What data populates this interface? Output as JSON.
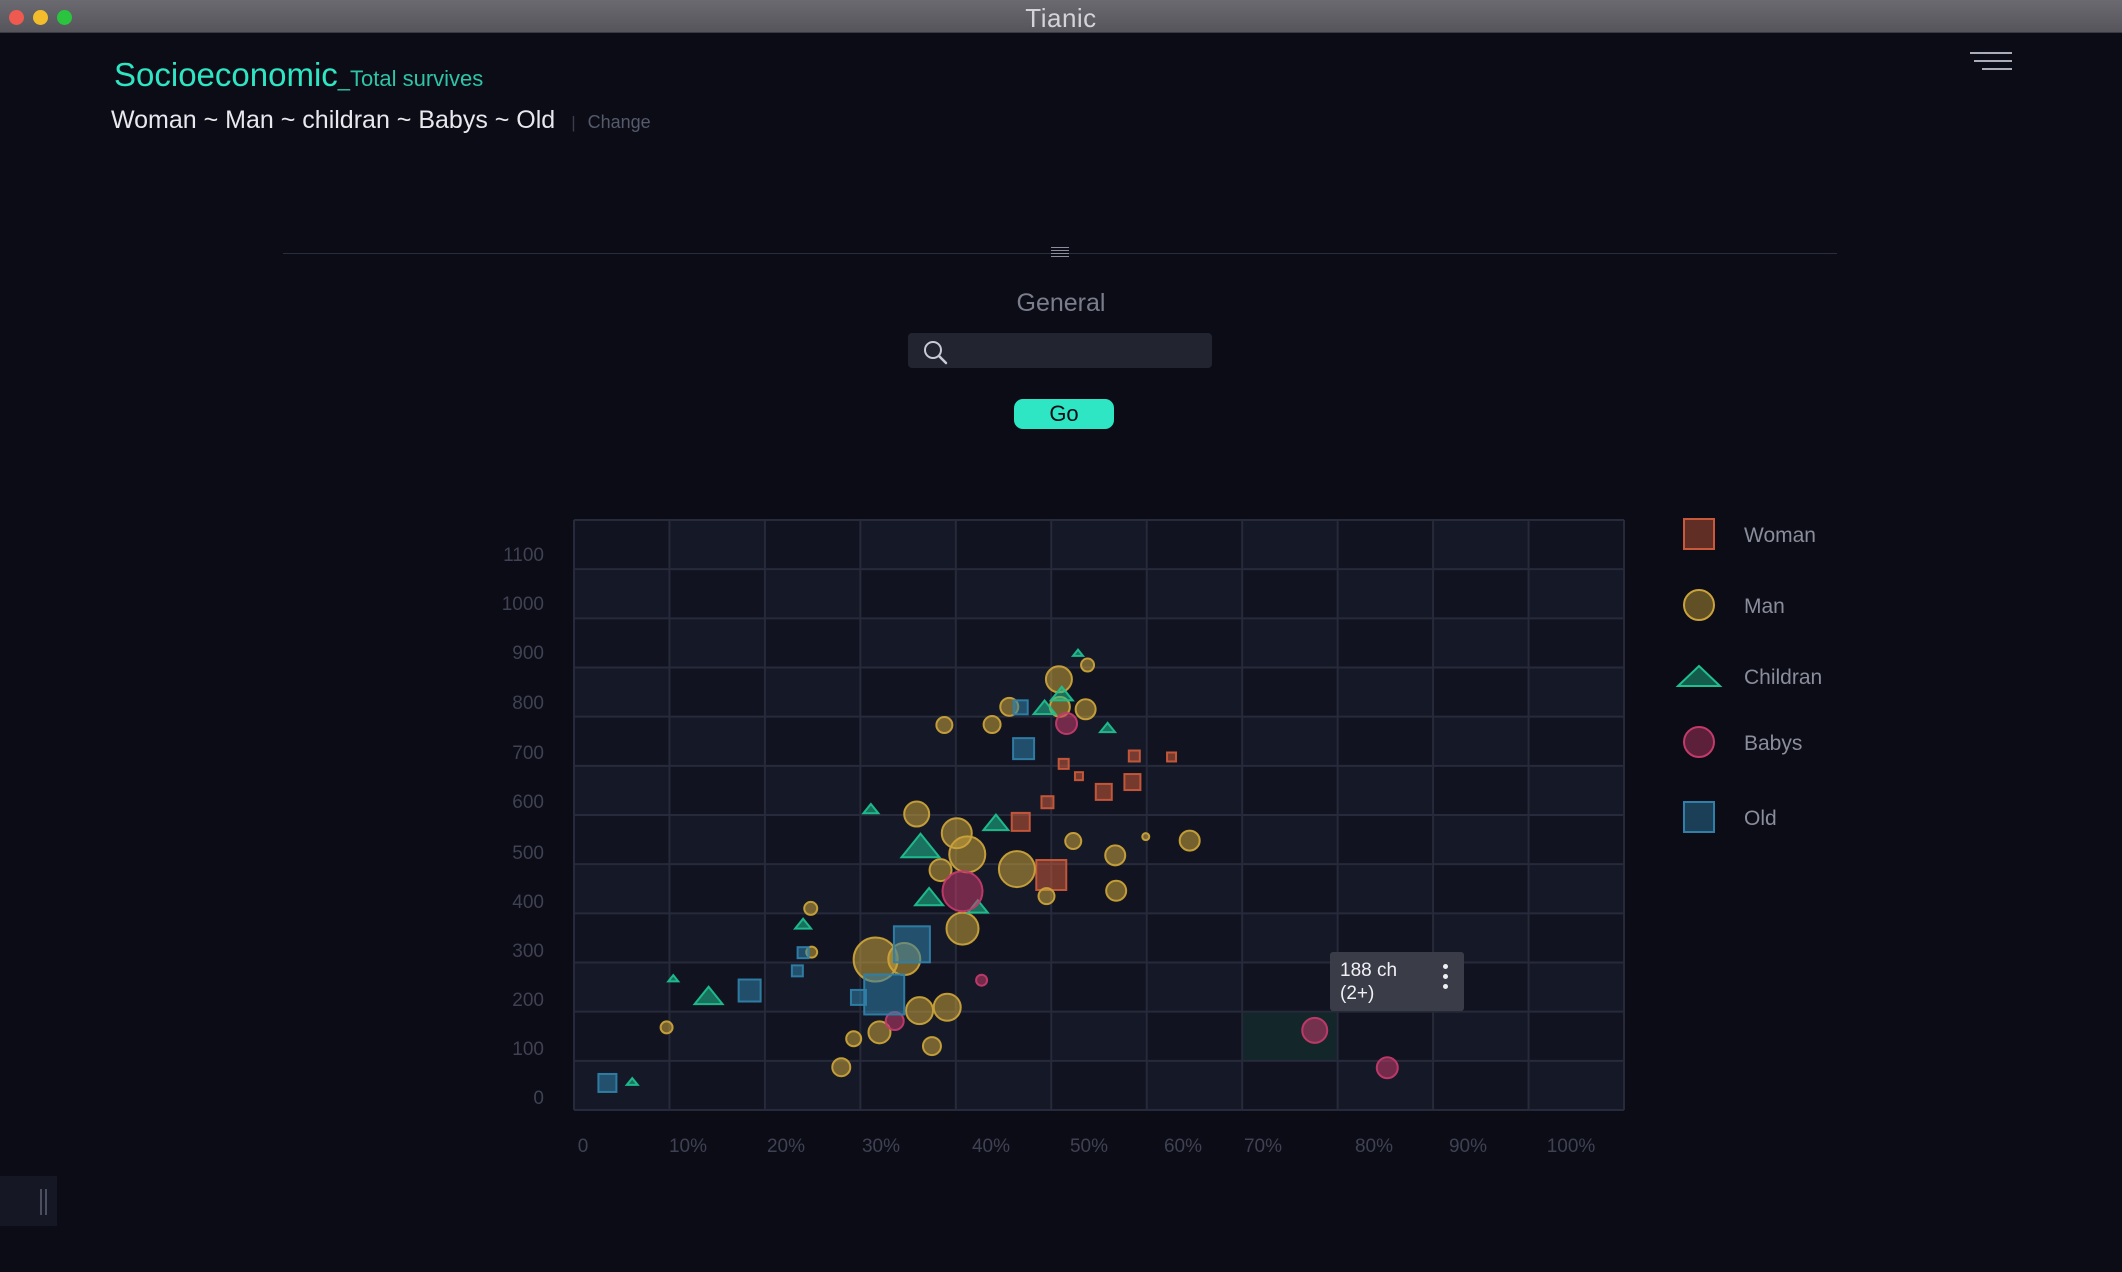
{
  "window": {
    "title": "Tianic"
  },
  "header": {
    "title": "Socioeconomic",
    "subtitle": "_Total survives",
    "filter_text": "Woman ~ Man ~ childran ~ Babys ~ Old",
    "separator": "|",
    "change_label": "Change"
  },
  "panel": {
    "general_label": "General",
    "search_value": "",
    "go_label": "Go"
  },
  "tooltip": {
    "line1": "188 ch",
    "line2": "(2+)"
  },
  "colors": {
    "accent": "#2ee6c4",
    "woman": "#c9593a",
    "man": "#c9a23a",
    "childran": "#1fbf8f",
    "babys": "#c23a6a",
    "old": "#2f7fa8"
  },
  "icons": {
    "menu": "hamburger-menu-icon",
    "search": "magnifier-icon",
    "drag": "drag-handle-icon",
    "more": "vertical-ellipsis-icon"
  },
  "chart_data": {
    "type": "scatter",
    "x_tick_labels": [
      "0",
      "10%",
      "20%",
      "30%",
      "40%",
      "50%",
      "60%",
      "70%",
      "80%",
      "90%",
      "100%"
    ],
    "y_tick_labels": [
      "0",
      "100",
      "200",
      "300",
      "400",
      "500",
      "600",
      "700",
      "800",
      "900",
      "1000",
      "1100"
    ],
    "xlim": [
      0,
      110
    ],
    "ylim": [
      0,
      1200
    ],
    "grid": true,
    "legend_position": "right",
    "highlight_cell": {
      "x": [
        70,
        80
      ],
      "y": [
        100,
        200
      ]
    },
    "series": [
      {
        "name": "Woman",
        "shape": "square",
        "points": [
          {
            "x": 50.0,
            "y": 478,
            "s": 30
          },
          {
            "x": 46.8,
            "y": 586,
            "s": 18
          },
          {
            "x": 49.6,
            "y": 626,
            "s": 12
          },
          {
            "x": 51.3,
            "y": 704,
            "s": 10
          },
          {
            "x": 52.9,
            "y": 679,
            "s": 8
          },
          {
            "x": 55.5,
            "y": 647,
            "s": 16
          },
          {
            "x": 58.5,
            "y": 667,
            "s": 16
          },
          {
            "x": 58.7,
            "y": 720,
            "s": 11
          },
          {
            "x": 62.6,
            "y": 718,
            "s": 9
          }
        ]
      },
      {
        "name": "Man",
        "shape": "circle",
        "points": [
          {
            "x": 9.7,
            "y": 168,
            "s": 12
          },
          {
            "x": 24.8,
            "y": 410,
            "s": 13
          },
          {
            "x": 24.9,
            "y": 321,
            "s": 11
          },
          {
            "x": 28.0,
            "y": 87,
            "s": 18
          },
          {
            "x": 29.3,
            "y": 145,
            "s": 15
          },
          {
            "x": 31.6,
            "y": 306,
            "s": 44
          },
          {
            "x": 32.0,
            "y": 158,
            "s": 22
          },
          {
            "x": 34.6,
            "y": 307,
            "s": 32
          },
          {
            "x": 35.9,
            "y": 602,
            "s": 25
          },
          {
            "x": 36.2,
            "y": 202,
            "s": 27
          },
          {
            "x": 37.5,
            "y": 130,
            "s": 18
          },
          {
            "x": 38.4,
            "y": 488,
            "s": 22
          },
          {
            "x": 38.8,
            "y": 783,
            "s": 16
          },
          {
            "x": 39.1,
            "y": 209,
            "s": 27
          },
          {
            "x": 40.1,
            "y": 563,
            "s": 30
          },
          {
            "x": 41.2,
            "y": 520,
            "s": 36
          },
          {
            "x": 40.7,
            "y": 369,
            "s": 32
          },
          {
            "x": 43.8,
            "y": 784,
            "s": 17
          },
          {
            "x": 45.6,
            "y": 820,
            "s": 18
          },
          {
            "x": 46.4,
            "y": 490,
            "s": 36
          },
          {
            "x": 49.5,
            "y": 435,
            "s": 16
          },
          {
            "x": 50.8,
            "y": 876,
            "s": 26
          },
          {
            "x": 50.9,
            "y": 820,
            "s": 20
          },
          {
            "x": 53.8,
            "y": 905,
            "s": 13
          },
          {
            "x": 53.6,
            "y": 815,
            "s": 20
          },
          {
            "x": 52.3,
            "y": 547,
            "s": 16
          },
          {
            "x": 56.7,
            "y": 518,
            "s": 20
          },
          {
            "x": 56.8,
            "y": 446,
            "s": 20
          },
          {
            "x": 59.9,
            "y": 556,
            "s": 7
          },
          {
            "x": 64.5,
            "y": 548,
            "s": 20
          }
        ]
      },
      {
        "name": "Childran",
        "shape": "triangle",
        "points": [
          {
            "x": 6.1,
            "y": 58,
            "s": 11
          },
          {
            "x": 10.4,
            "y": 268,
            "s": 10
          },
          {
            "x": 14.1,
            "y": 233,
            "s": 28
          },
          {
            "x": 24.0,
            "y": 379,
            "s": 16
          },
          {
            "x": 31.1,
            "y": 613,
            "s": 15
          },
          {
            "x": 36.3,
            "y": 538,
            "s": 38
          },
          {
            "x": 37.2,
            "y": 434,
            "s": 28
          },
          {
            "x": 42.3,
            "y": 414,
            "s": 20
          },
          {
            "x": 44.2,
            "y": 585,
            "s": 25
          },
          {
            "x": 49.3,
            "y": 819,
            "s": 22
          },
          {
            "x": 51.1,
            "y": 847,
            "s": 22
          },
          {
            "x": 52.8,
            "y": 930,
            "s": 10
          },
          {
            "x": 55.9,
            "y": 778,
            "s": 15
          }
        ]
      },
      {
        "name": "Babys",
        "shape": "circle",
        "points": [
          {
            "x": 33.6,
            "y": 181,
            "s": 18
          },
          {
            "x": 40.7,
            "y": 445,
            "s": 40
          },
          {
            "x": 42.7,
            "y": 264,
            "s": 11
          },
          {
            "x": 51.6,
            "y": 786,
            "s": 21
          },
          {
            "x": 77.6,
            "y": 162,
            "s": 25
          },
          {
            "x": 85.2,
            "y": 86,
            "s": 21
          }
        ]
      },
      {
        "name": "Old",
        "shape": "square",
        "points": [
          {
            "x": 3.5,
            "y": 55,
            "s": 18
          },
          {
            "x": 18.4,
            "y": 243,
            "s": 22
          },
          {
            "x": 23.4,
            "y": 283,
            "s": 11
          },
          {
            "x": 24.0,
            "y": 320,
            "s": 11
          },
          {
            "x": 29.8,
            "y": 229,
            "s": 15
          },
          {
            "x": 32.5,
            "y": 235,
            "s": 40
          },
          {
            "x": 35.4,
            "y": 337,
            "s": 36
          },
          {
            "x": 47.1,
            "y": 735,
            "s": 21
          },
          {
            "x": 46.8,
            "y": 819,
            "s": 14
          }
        ]
      }
    ]
  }
}
